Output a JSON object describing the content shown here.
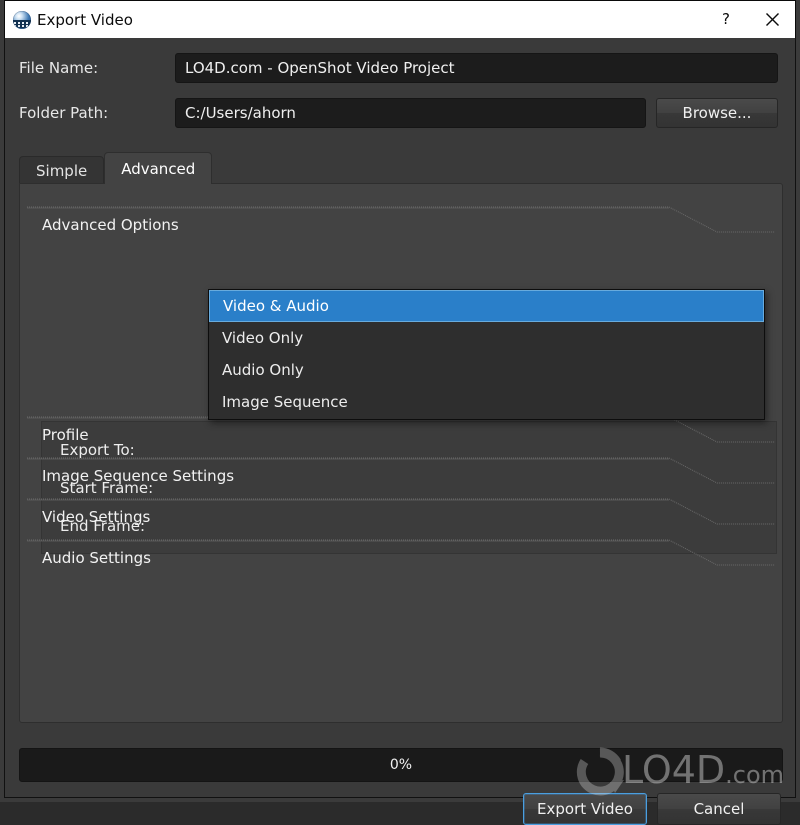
{
  "window": {
    "title": "Export Video",
    "icon": "openshot-logo-icon",
    "help_button": "?",
    "close_button": "✕"
  },
  "form": {
    "file_name_label": "File Name:",
    "file_name_value": "LO4D.com - OpenShot Video Project",
    "file_name_placeholder": "",
    "folder_path_label": "Folder Path:",
    "folder_path_value": "C:/Users/ahorn",
    "folder_path_placeholder": "",
    "browse_label": "Browse..."
  },
  "tabs": [
    {
      "label": "Simple",
      "active": false
    },
    {
      "label": "Advanced",
      "active": true
    }
  ],
  "sections": [
    {
      "title": "Advanced Options",
      "expanded": true
    },
    {
      "title": "Profile",
      "expanded": false
    },
    {
      "title": "Image Sequence Settings",
      "expanded": false
    },
    {
      "title": "Video Settings",
      "expanded": false
    },
    {
      "title": "Audio Settings",
      "expanded": false
    }
  ],
  "advanced_options": {
    "export_to_label": "Export To:",
    "export_to_value": "Video & Audio",
    "start_frame_label": "Start Frame:",
    "end_frame_label": "End Frame:"
  },
  "dropdown": {
    "open": true,
    "options": [
      "Video & Audio",
      "Video Only",
      "Audio Only",
      "Image Sequence"
    ],
    "selected_index": 0
  },
  "progress": {
    "label": "0%",
    "percent": 0
  },
  "buttons": {
    "export_label": "Export Video",
    "cancel_label": "Cancel"
  },
  "watermark": {
    "text": "LO4D",
    "suffix": ".com"
  },
  "colors": {
    "accent_blue": "#2a7fc9",
    "accent_blue_border": "#68abdd",
    "dialog_bg": "#3a3a3a",
    "panel_bg": "#434343",
    "input_bg": "#1c1c1c",
    "titlebar_bg": "#ffffff",
    "text": "#efefef"
  }
}
